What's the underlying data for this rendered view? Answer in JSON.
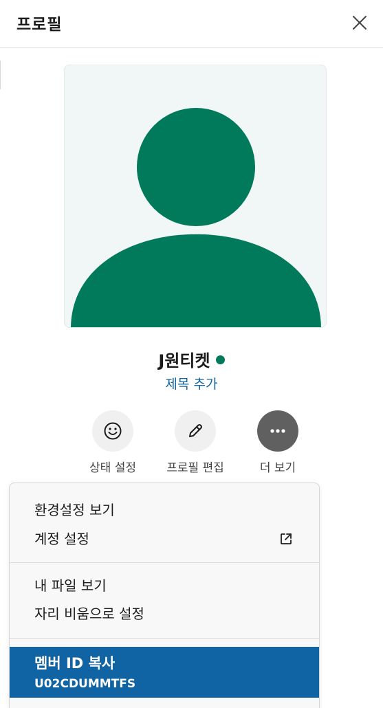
{
  "header": {
    "title": "프로필"
  },
  "profile": {
    "display_name": "J원티켓",
    "presence": "active",
    "add_title_label": "제목 추가",
    "avatar_color": "#007a5a",
    "avatar_bg": "#f1f6f6"
  },
  "actions": [
    {
      "label": "상태 설정",
      "icon": "smile-icon"
    },
    {
      "label": "프로필 편집",
      "icon": "pencil-icon"
    },
    {
      "label": "더 보기",
      "icon": "more-dots-icon"
    }
  ],
  "menu": {
    "group1": [
      {
        "label": "환경설정 보기"
      },
      {
        "label": "계정 설정",
        "icon": "external-link-icon"
      }
    ],
    "group2": [
      {
        "label": "내 파일 보기"
      },
      {
        "label": "자리 비움으로 설정"
      }
    ],
    "copy_member": {
      "label": "멤버 ID 복사",
      "member_id": "U02CDUMMTFS"
    }
  },
  "colors": {
    "accent": "#1164a3",
    "presence": "#007a5a",
    "link": "#1264a3"
  }
}
